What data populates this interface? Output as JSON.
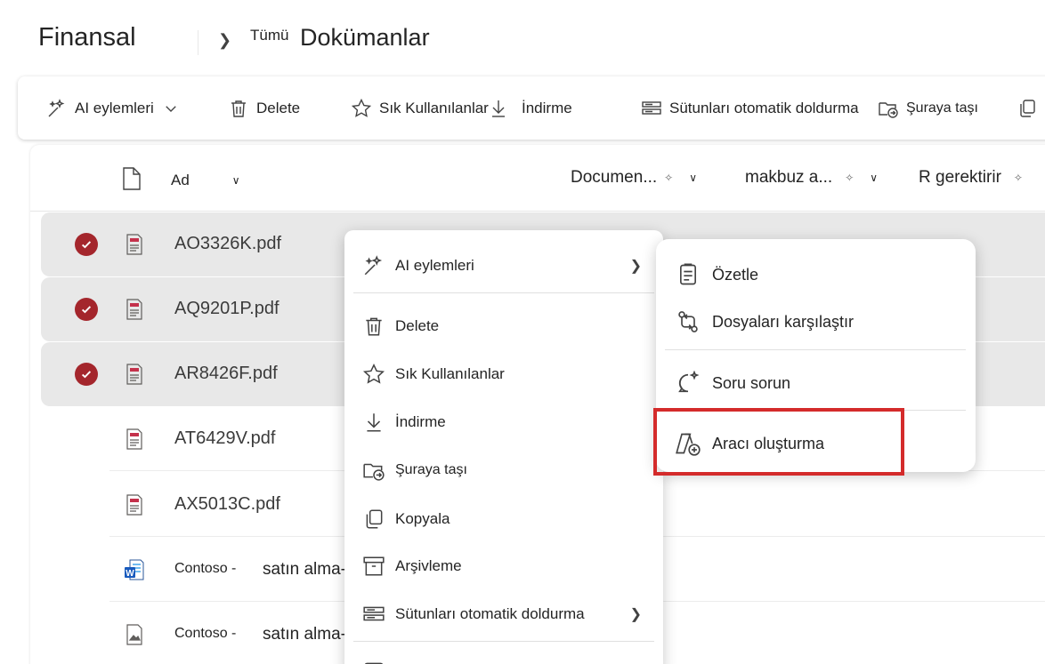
{
  "header": {
    "site_title": "Finansal",
    "breadcrumb_small": "Tümü",
    "library_title": "Dokümanlar"
  },
  "toolbar": {
    "ai_actions": "AI eylemleri",
    "delete": "Delete",
    "favorites": "Sık Kullanılanlar",
    "download": "İndirme",
    "autofill": "Sütunları otomatik doldurma",
    "move_to": "Şuraya taşı"
  },
  "columns": {
    "name": "Ad",
    "document": "Documen...",
    "receipt": "makbuz a...",
    "required": "R gerektirir"
  },
  "files": [
    {
      "name": "AO3326K.pdf",
      "selected": true,
      "type": "pdf-icon"
    },
    {
      "name": "AQ9201P.pdf",
      "selected": true,
      "type": "pdf-icon"
    },
    {
      "name": "AR8426F.pdf",
      "selected": true,
      "type": "pdf-icon"
    },
    {
      "name": "AT6429V.pdf",
      "selected": false,
      "type": "pdf-icon"
    },
    {
      "name": "AX5013C.pdf",
      "selected": false,
      "type": "pdf-icon"
    },
    {
      "name": "Contoso -",
      "name_tail": "satın alma-",
      "selected": false,
      "type": "word-icon"
    },
    {
      "name": "Contoso -",
      "name_tail": "satın alma-",
      "selected": false,
      "type": "image-icon"
    }
  ],
  "context_menu": {
    "ai_actions": "AI eylemleri",
    "delete": "Delete",
    "favorites": "Sık Kullanılanlar",
    "download": "İndirme",
    "move_to": "Şuraya taşı",
    "copy": "Kopyala",
    "archive": "Arşivleme",
    "autofill": "Sütunları otomatik doldurma"
  },
  "submenu": {
    "summarize": "Özetle",
    "compare": "Dosyaları karşılaştır",
    "ask": "Soru sorun",
    "create_agent": "Aracı oluşturma"
  },
  "colors": {
    "accent_check": "#a4262c",
    "highlight_box": "#d42b2b",
    "selected_row": "#e8e8e8"
  }
}
